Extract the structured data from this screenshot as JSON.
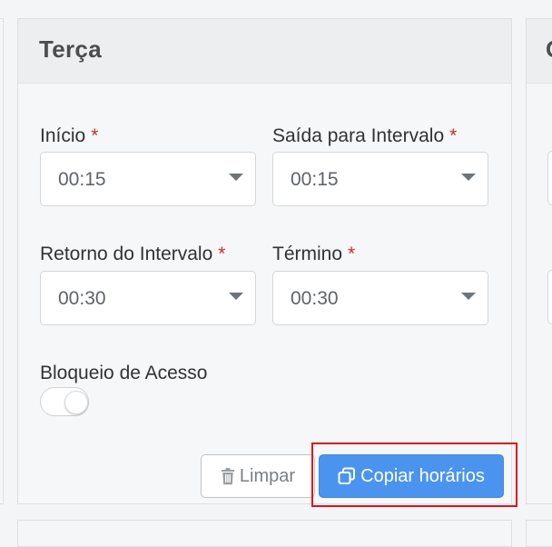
{
  "day_card": {
    "title": "Terça",
    "fields": {
      "inicio": {
        "label": "Início",
        "value": "00:15",
        "required_mark": "*"
      },
      "saida_intervalo": {
        "label": "Saída para Intervalo",
        "value": "00:15",
        "required_mark": "*"
      },
      "retorno_intervalo": {
        "label": "Retorno do Intervalo",
        "value": "00:30",
        "required_mark": "*"
      },
      "termino": {
        "label": "Término",
        "value": "00:30",
        "required_mark": "*"
      }
    },
    "bloqueio": {
      "label": "Bloqueio de Acesso",
      "enabled": false
    },
    "buttons": {
      "limpar": "Limpar",
      "copiar": "Copiar horários"
    }
  },
  "next_card": {
    "title_partial": "Q"
  },
  "colors": {
    "required": "#cc2b2b",
    "primary_button": "#4a94f0",
    "highlight": "#e01218"
  },
  "icons": {
    "limpar": "trash-icon",
    "copiar": "copy-icon",
    "select": "chevron-down-icon"
  }
}
